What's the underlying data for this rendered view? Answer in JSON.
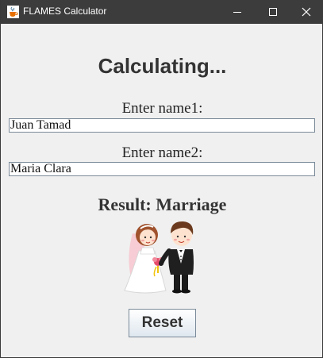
{
  "window": {
    "title": "FLAMES Calculator",
    "icons": {
      "app": "java-cup-icon",
      "minimize": "minimize-icon",
      "maximize": "maximize-icon",
      "close": "close-icon"
    }
  },
  "main": {
    "heading": "Calculating...",
    "name1_label": "Enter name1:",
    "name1_value": "Juan Tamad",
    "name2_label": "Enter name2:",
    "name2_value": "Maria Clara",
    "result": "Result: Marriage",
    "result_image": "bride-and-groom-illustration",
    "reset_label": "Reset"
  }
}
